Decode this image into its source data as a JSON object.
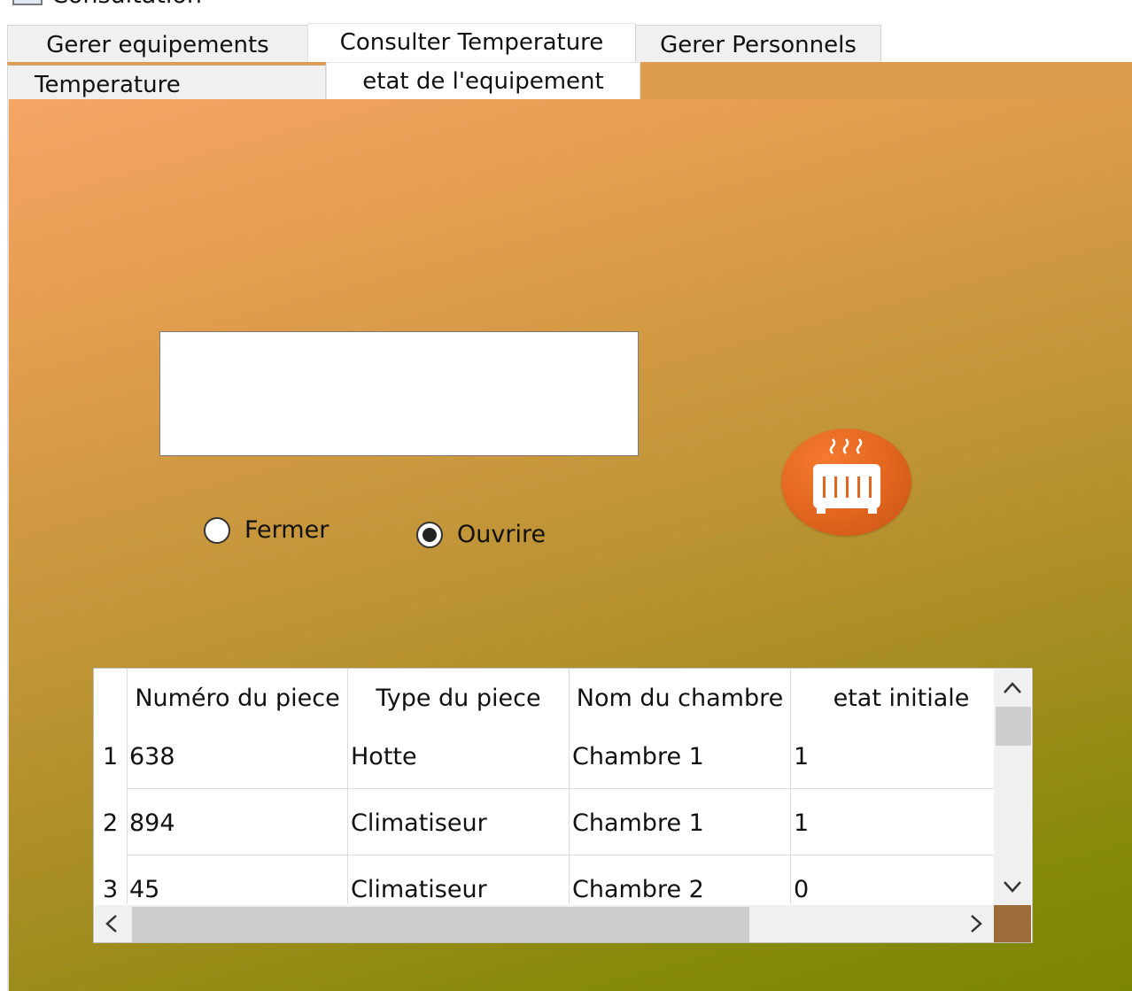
{
  "window": {
    "title": "Consultation"
  },
  "main_tabs": [
    {
      "label": "Gerer equipements"
    },
    {
      "label": "Consulter Temperature"
    },
    {
      "label": "Gerer Personnels"
    }
  ],
  "sub_tabs": [
    {
      "label": "Temperature"
    },
    {
      "label": "etat de l'equipement"
    }
  ],
  "text_area": {
    "value": ""
  },
  "radio_options": [
    {
      "label": "Fermer",
      "checked": false
    },
    {
      "label": "Ouvrire",
      "checked": true
    }
  ],
  "heater_button": {
    "icon": "radiator-icon"
  },
  "table": {
    "columns": [
      "Numéro du piece",
      "Type du piece",
      "Nom du chambre",
      "etat initiale"
    ],
    "rows": [
      {
        "num": "1",
        "cells": [
          "638",
          "Hotte",
          "Chambre 1",
          "1"
        ]
      },
      {
        "num": "2",
        "cells": [
          "894",
          "Climatiseur",
          "Chambre 1",
          "1"
        ]
      },
      {
        "num": "3",
        "cells": [
          "45",
          "Climatiseur",
          "Chambre 2",
          "0"
        ]
      }
    ]
  },
  "colors": {
    "panel_top": "#f5a565",
    "panel_bottom": "#7b8600",
    "button_orange": "#e0651e",
    "corner": "#9b6b38"
  }
}
